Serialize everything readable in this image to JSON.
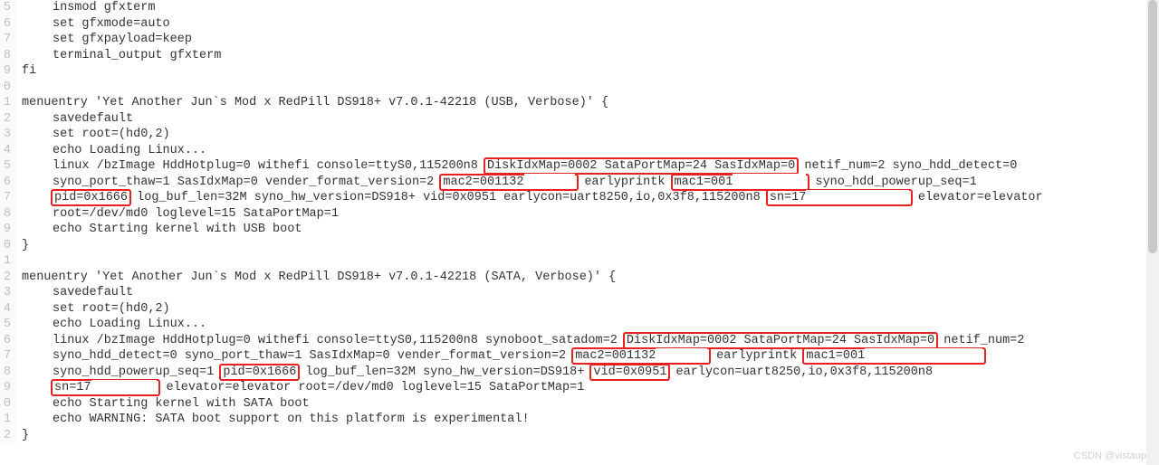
{
  "gutter_start": 5,
  "gutter_end": 31,
  "lines": {
    "l5": "insmod gfxterm",
    "l6": "set gfxmode=auto",
    "l7": "set gfxpayload=keep",
    "l8": "terminal_output gfxterm",
    "l9": "fi",
    "l10": " ",
    "l11": "menuentry 'Yet Another Jun`s Mod x RedPill DS918+ v7.0.1-42218 (USB, Verbose)' {",
    "l12": "savedefault",
    "l13": "set root=(hd0,2)",
    "l14": "echo Loading Linux...",
    "l15a": "linux /bzImage HddHotplug=0 withefi console=ttyS0,115200n8 ",
    "l15b": "DiskIdxMap=0002 SataPortMap=24 SasIdxMap=0",
    "l15c": " netif_num=2 syno_hdd_detect=0 ",
    "l16a": "syno_port_thaw=1 SasIdxMap=0 vender_format_version=2 ",
    "l16b": "mac2=001132",
    "l16c": " earlyprintk ",
    "l16d": "mac1=001",
    "l16e": " syno_hdd_powerup_seq=1 ",
    "l17a": "pid=0x1666",
    "l17b": " log_buf_len=32M syno_hw_version=DS918+ vid=0x0951 earlycon=uart8250,io,0x3f8,115200n8 ",
    "l17c": "sn=17",
    "l17d": " elevator=elevator ",
    "l18": "root=/dev/md0 loglevel=15 SataPortMap=1",
    "l19": "echo Starting kernel with USB boot",
    "l20": "}",
    "l21": " ",
    "l22": "menuentry 'Yet Another Jun`s Mod x RedPill DS918+ v7.0.1-42218 (SATA, Verbose)' {",
    "l23": "savedefault",
    "l24": "set root=(hd0,2)",
    "l25": "echo Loading Linux...",
    "l26a": "linux /bzImage HddHotplug=0 withefi console=ttyS0,115200n8 synoboot_satadom=2 ",
    "l26b": "DiskIdxMap=0002 SataPortMap=24 SasIdxMap=0",
    "l26c": " netif_num=2 ",
    "l27a": "syno_hdd_detect=0 syno_port_thaw=1 SasIdxMap=0 vender_format_version=2 ",
    "l27b": "mac2=001132",
    "l27c": " earlyprintk ",
    "l27d": "mac1=001",
    "l27e": " ",
    "l28a": "syno_hdd_powerup_seq=1 ",
    "l28b": "pid=0x1666",
    "l28c": " log_buf_len=32M syno_hw_version=DS918+ ",
    "l28d": "vid=0x0951",
    "l28e": " earlycon=uart8250,io,0x3f8,115200n8 ",
    "l29a": "sn=17",
    "l29b": " elevator=elevator root=/dev/md0 loglevel=15 SataPortMap=1",
    "l30": "echo Starting kernel with SATA boot",
    "l31": "echo WARNING: SATA boot support on this platform is experimental!",
    "l32": "}"
  },
  "watermark": "CSDN @vistaup",
  "masks": {
    "m1": "XXXXXXX",
    "m2": "XXXXXXXXXX",
    "m3": "XXXXXXXXXXXXXX",
    "m4": "XXXXXXX",
    "m5": "XXXXXXXXXXXXXXXX",
    "m6": "XXXXXXXXX"
  }
}
